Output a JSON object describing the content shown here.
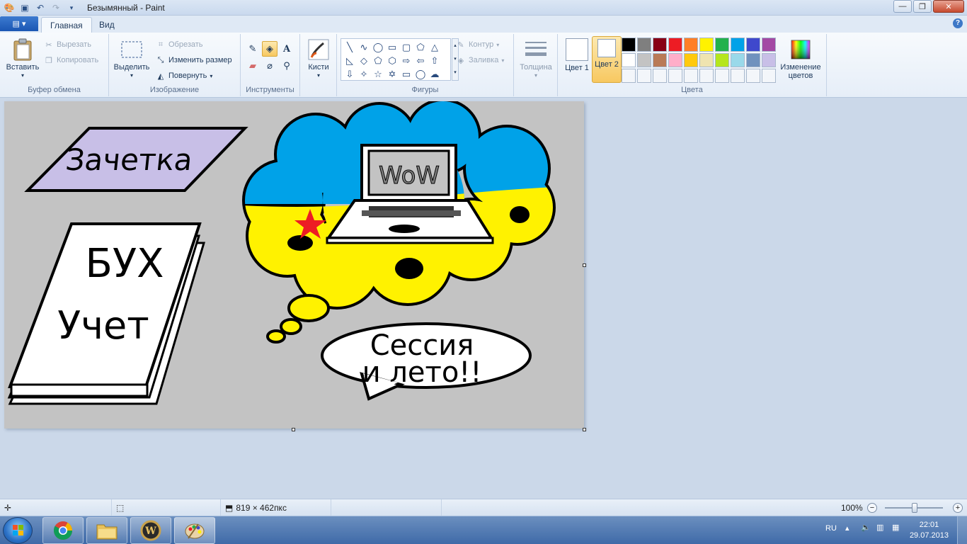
{
  "window": {
    "title": "Безымянный - Paint"
  },
  "tabs": {
    "home": "Главная",
    "view": "Вид"
  },
  "clipboard": {
    "paste": "Вставить",
    "cut": "Вырезать",
    "copy": "Копировать",
    "label": "Буфер обмена"
  },
  "image": {
    "select": "Выделить",
    "crop": "Обрезать",
    "resize": "Изменить размер",
    "rotate": "Повернуть",
    "label": "Изображение"
  },
  "tools": {
    "label": "Инструменты"
  },
  "brushes": {
    "label": "Кисти"
  },
  "shapes": {
    "outline": "Контур",
    "fill": "Заливка",
    "label": "Фигуры"
  },
  "size": {
    "label": "Толщина"
  },
  "colors": {
    "color1": "Цвет 1",
    "color2": "Цвет 2",
    "edit": "Изменение цветов",
    "label": "Цвета",
    "palette": [
      "#000000",
      "#7f7f7f",
      "#880015",
      "#ed1c24",
      "#ff7f27",
      "#fff200",
      "#22b14c",
      "#00a2e8",
      "#3f48cc",
      "#a349a4",
      "#ffffff",
      "#c3c3c3",
      "#b97a57",
      "#ffaec9",
      "#ffc90e",
      "#efe4b0",
      "#b5e61d",
      "#99d9ea",
      "#7092be",
      "#c8bfe7",
      "",
      "",
      "",
      "",
      "",
      "",
      "",
      "",
      "",
      ""
    ]
  },
  "drawing": {
    "note_text": "Зачетка",
    "book_line1": "БУХ",
    "book_line2": "Учет",
    "laptop_text": "WoW",
    "bubble_line1": "Сессия",
    "bubble_line2": "и лето!!"
  },
  "status": {
    "size": "819 × 462пкс",
    "zoom": "100%"
  },
  "tray": {
    "lang": "RU",
    "time": "22:01",
    "date": "29.07.2013"
  }
}
